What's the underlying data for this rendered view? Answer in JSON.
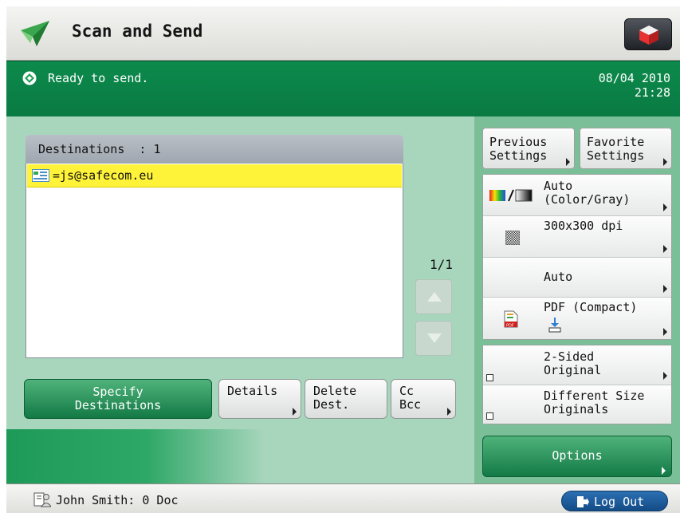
{
  "header": {
    "title": "Scan and Send",
    "logo_icon": "paper-plane-icon",
    "menu_icon": "cube-icon"
  },
  "status": {
    "text": "Ready to send.",
    "date": "08/04 2010",
    "time": "21:28",
    "color": "#0a7a42"
  },
  "destinations": {
    "header": "Destinations  : 1",
    "items": [
      {
        "address": "=js@safecom.eu",
        "icon": "email-icon",
        "selected": true
      }
    ],
    "page_indicator": "1/1"
  },
  "buttons": {
    "specify_line1": "Specify",
    "specify_line2": "Destinations",
    "details": "Details",
    "delete_line1": "Delete",
    "delete_line2": "Dest.",
    "cc_line1": "Cc",
    "cc_line2": "Bcc"
  },
  "settings": {
    "previous_line1": "Previous",
    "previous_line2": "Settings",
    "favorite_line1": "Favorite",
    "favorite_line2": "Settings",
    "color_line1": "Auto",
    "color_line2": "(Color/Gray)",
    "resolution": "300x300 dpi",
    "density": "Auto",
    "file_format": "PDF (Compact)",
    "two_sided_line1": "2-Sided",
    "two_sided_line2": "Original",
    "diff_size_line1": "Different Size",
    "diff_size_line2": "Originals",
    "options": "Options"
  },
  "footer": {
    "user": "John Smith: 0 Doc",
    "logout": "Log Out"
  },
  "colors": {
    "accent_green": "#137a46",
    "selection_yellow": "#fff33a",
    "logout_blue": "#1d5c9c"
  }
}
